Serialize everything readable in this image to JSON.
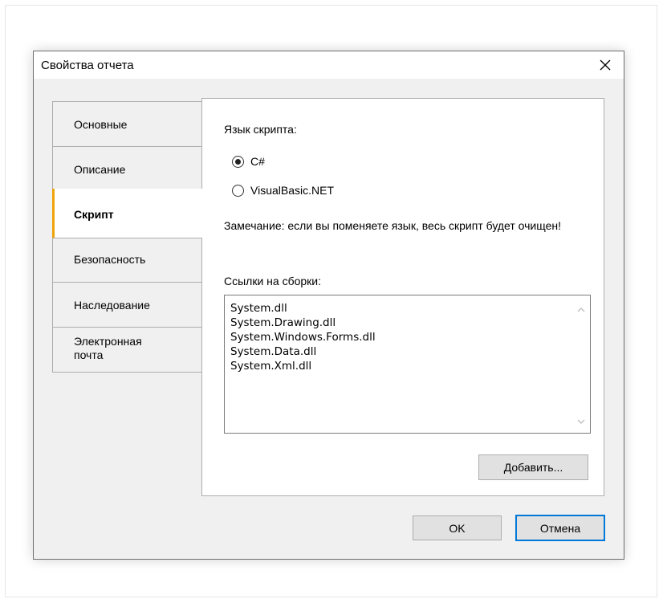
{
  "dialog": {
    "title": "Свойства отчета",
    "close_icon": "close-icon"
  },
  "tabs": [
    {
      "label": "Основные",
      "active": false
    },
    {
      "label": "Описание",
      "active": false
    },
    {
      "label": "Скрипт",
      "active": true
    },
    {
      "label": "Безопасность",
      "active": false
    },
    {
      "label": "Наследование",
      "active": false
    },
    {
      "label": "Электронная\nпочта",
      "active": false
    }
  ],
  "script_page": {
    "language_label": "Язык скрипта:",
    "radio_csharp": {
      "label": "C#",
      "checked": true
    },
    "radio_vb": {
      "label": "VisualBasic.NET",
      "checked": false
    },
    "note": "Замечание: если вы поменяете язык, весь скрипт будет очищен!",
    "assemblies_label": "Ссылки на сборки:",
    "assemblies": [
      "System.dll",
      "System.Drawing.dll",
      "System.Windows.Forms.dll",
      "System.Data.dll",
      "System.Xml.dll"
    ],
    "add_button": "Добавить..."
  },
  "footer": {
    "ok_button": "OK",
    "cancel_button": "Отмена"
  },
  "colors": {
    "active_tab_accent": "#f0a30a",
    "default_button_border": "#0078d7"
  }
}
